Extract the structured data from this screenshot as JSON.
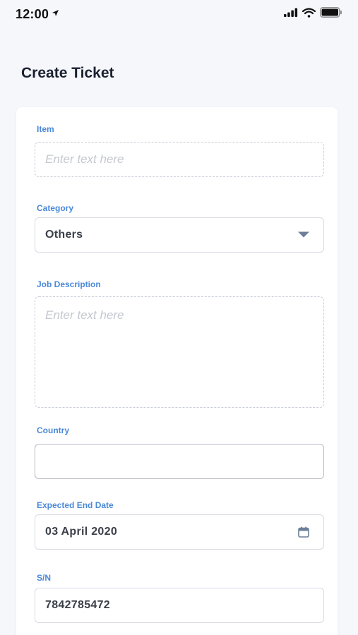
{
  "status_bar": {
    "time": "12:00",
    "icons": [
      "location-arrow-icon",
      "cellular-signal-icon",
      "wifi-icon",
      "battery-icon"
    ]
  },
  "page": {
    "title": "Create Ticket"
  },
  "form": {
    "item": {
      "label": "Item",
      "placeholder": "Enter text here",
      "value": ""
    },
    "category": {
      "label": "Category",
      "selected": "Others",
      "icon": "dropdown-triangle-icon"
    },
    "job_description": {
      "label": "Job Description",
      "placeholder": "Enter text here",
      "value": ""
    },
    "country": {
      "label": "Country",
      "value": ""
    },
    "expected_end_date": {
      "label": "Expected End Date",
      "value": "03 April 2020",
      "icon": "calendar-icon"
    },
    "serial_number": {
      "label": "S/N",
      "value": "7842785472"
    }
  },
  "colors": {
    "background": "#f5f7fb",
    "card": "#ffffff",
    "label_accent": "#4a88d8",
    "title": "#1b2130",
    "icon": "#6d7f99"
  }
}
